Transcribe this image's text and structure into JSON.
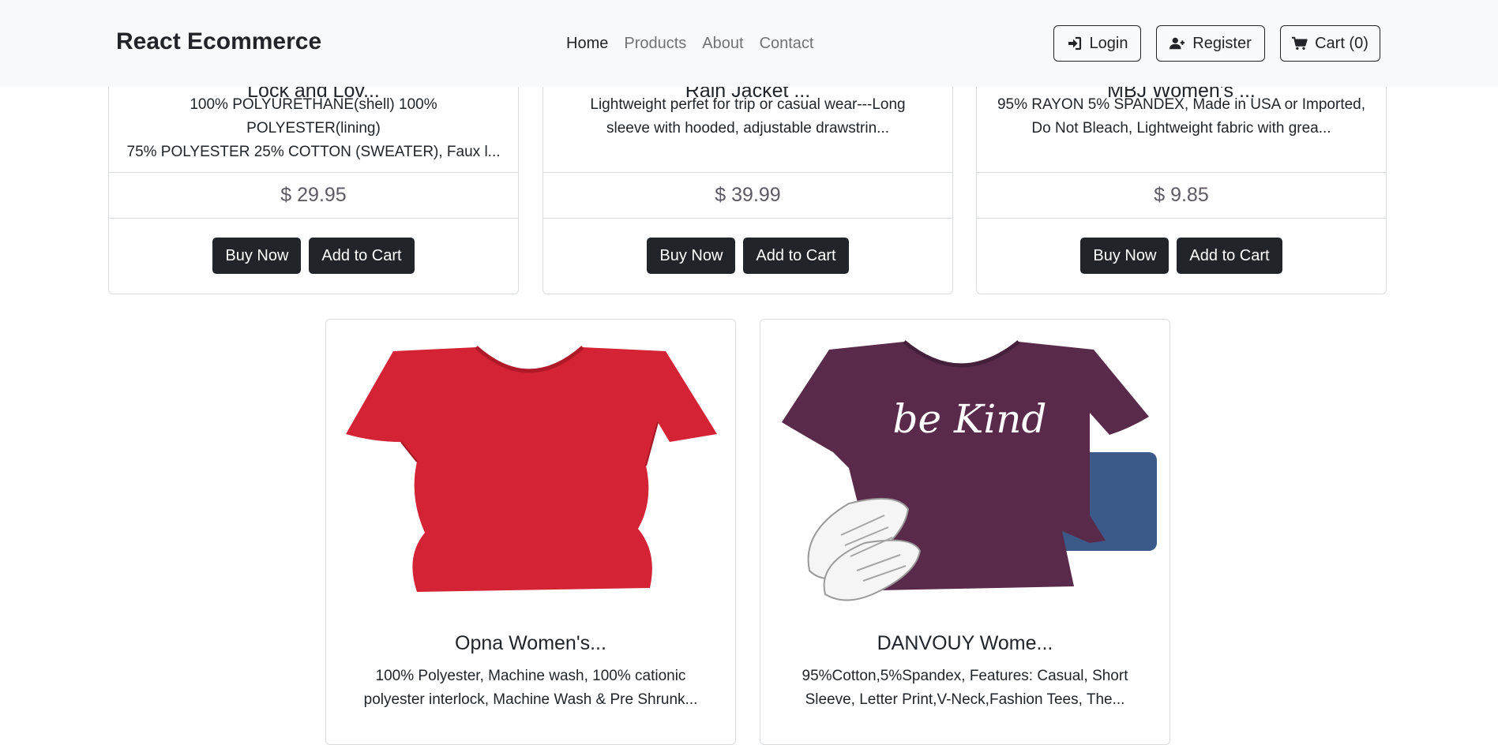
{
  "navbar": {
    "brand": "React Ecommerce",
    "links": [
      {
        "label": "Home"
      },
      {
        "label": "Products"
      },
      {
        "label": "About"
      },
      {
        "label": "Contact"
      }
    ],
    "login_label": "Login",
    "register_label": "Register",
    "cart_label": "Cart (0)"
  },
  "products": [
    {
      "title": "Lock and Lov...",
      "desc_line1": "100% POLYURETHANE(shell) 100% POLYESTER(lining)",
      "desc_line2": "75% POLYESTER 25% COTTON (SWEATER), Faux l...",
      "price": "$ 29.95",
      "buy_label": "Buy Now",
      "cart_label": "Add to Cart"
    },
    {
      "title": "Rain Jacket ...",
      "desc_line1": "Lightweight perfet for trip or casual wear---Long",
      "desc_line2": "sleeve with hooded, adjustable drawstrin...",
      "price": "$ 39.99",
      "buy_label": "Buy Now",
      "cart_label": "Add to Cart"
    },
    {
      "title": "MBJ Women's ...",
      "desc_line1": "95% RAYON 5% SPANDEX, Made in USA or Imported,",
      "desc_line2": "Do Not Bleach, Lightweight fabric with grea...",
      "price": "$ 9.85",
      "buy_label": "Buy Now",
      "cart_label": "Add to Cart"
    },
    {
      "title": "Opna Women's...",
      "desc_line1": "100% Polyester, Machine wash, 100% cationic",
      "desc_line2": "polyester interlock, Machine Wash & Pre Shrunk...",
      "image_color": "#d42334"
    },
    {
      "title": "DANVOUY Wome...",
      "desc_line1": "95%Cotton,5%Spandex, Features: Casual, Short",
      "desc_line2": "Sleeve, Letter Print,V-Neck,Fashion Tees, The...",
      "image_color": "#5a2a4a",
      "image_print": "be Kind"
    }
  ]
}
